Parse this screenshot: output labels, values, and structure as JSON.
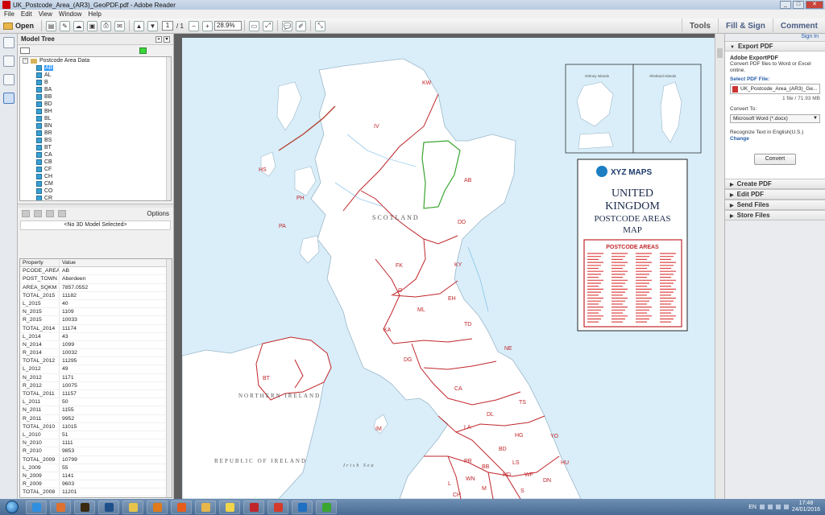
{
  "window": {
    "title": "UK_Postcode_Area_(AR3)_GeoPDF.pdf - Adobe Reader"
  },
  "menu": [
    "File",
    "Edit",
    "View",
    "Window",
    "Help"
  ],
  "toolbar": {
    "open_label": "Open",
    "page_current": "1",
    "page_total": "/ 1",
    "zoom": "28.9%",
    "tabs": [
      "Tools",
      "Fill & Sign",
      "Comment"
    ]
  },
  "left_strip_icons": [
    "pages-icon",
    "attachment-icon",
    "layers-icon",
    "model-tree-icon"
  ],
  "model_tree": {
    "title": "Model Tree",
    "root_label": "Postcode Area Data",
    "items": [
      "AB",
      "AL",
      "B",
      "BA",
      "BB",
      "BD",
      "BH",
      "BL",
      "BN",
      "BR",
      "BS",
      "BT",
      "CA",
      "CB",
      "CF",
      "CH",
      "CM",
      "CO",
      "CR"
    ],
    "selected": "AB",
    "options_label": "Options",
    "no_model_label": "<No 3D Model Selected>"
  },
  "properties": {
    "headers": [
      "Property",
      "Value"
    ],
    "rows": [
      [
        "PCODE_AREA",
        "AB"
      ],
      [
        "POST_TOWN",
        "Aberdeen"
      ],
      [
        "AREA_SQKM",
        "7857.0552"
      ],
      [
        "TOTAL_2015",
        "11182"
      ],
      [
        "L_2015",
        "40"
      ],
      [
        "N_2015",
        "1109"
      ],
      [
        "R_2015",
        "10033"
      ],
      [
        "TOTAL_2014",
        "11174"
      ],
      [
        "L_2014",
        "43"
      ],
      [
        "N_2014",
        "1099"
      ],
      [
        "R_2014",
        "10032"
      ],
      [
        "TOTAL_2012",
        "11295"
      ],
      [
        "L_2012",
        "49"
      ],
      [
        "N_2012",
        "1171"
      ],
      [
        "R_2012",
        "10075"
      ],
      [
        "TOTAL_2011",
        "11157"
      ],
      [
        "L_2011",
        "50"
      ],
      [
        "N_2011",
        "1155"
      ],
      [
        "R_2011",
        "9952"
      ],
      [
        "TOTAL_2010",
        "11015"
      ],
      [
        "L_2010",
        "51"
      ],
      [
        "N_2010",
        "1111"
      ],
      [
        "R_2010",
        "9853"
      ],
      [
        "TOTAL_2009",
        "10799"
      ],
      [
        "L_2009",
        "55"
      ],
      [
        "N_2009",
        "1141"
      ],
      [
        "R_2009",
        "9603"
      ],
      [
        "TOTAL_2008",
        "11201"
      ]
    ]
  },
  "map": {
    "brand": "XYZ MAPS",
    "title_lines": [
      "UNITED",
      "KINGDOM",
      "POSTCODE AREAS",
      "MAP"
    ],
    "legend_title": "POSTCODE AREAS",
    "inset_labels": [
      "Orkney Islands",
      "Shetland Islands"
    ],
    "place_labels": [
      "SCOTLAND",
      "NORTHERN IRELAND",
      "REPUBLIC OF IRELAND",
      "Irish Sea"
    ],
    "area_codes": [
      "KW",
      "IV",
      "HS",
      "PH",
      "AB",
      "DD",
      "PA",
      "FK",
      "KY",
      "G",
      "EH",
      "ML",
      "KA",
      "TD",
      "DG",
      "NE",
      "CA",
      "BT",
      "LA",
      "DL",
      "TS",
      "IM",
      "YO",
      "HG",
      "BD",
      "HU",
      "PR",
      "BB",
      "LS",
      "HD",
      "WF",
      "DN",
      "L",
      "WN",
      "M",
      "S",
      "CH"
    ],
    "colors": {
      "sea": "#d9eef9",
      "land": "#ffffff",
      "boundary": "#c0262b",
      "roads": "#7a7a7a",
      "water": "#6fb7e5"
    }
  },
  "export_panel": {
    "sign_in": "Sign In",
    "sections": [
      "Export PDF",
      "Create PDF",
      "Edit PDF",
      "Send Files",
      "Store Files"
    ],
    "service": "Adobe ExportPDF",
    "description": "Convert PDF files to Word or Excel online.",
    "select_label": "Select PDF File:",
    "file_name": "UK_Postcode_Area_(AR3)_Ge...",
    "file_count": "1 file / 71.93 MB",
    "convert_to_label": "Convert To:",
    "convert_to_value": "Microsoft Word (*.docx)",
    "recognize_label": "Recognize Text in English(U.S.)",
    "change_label": "Change",
    "convert_button": "Convert"
  },
  "taskbar": {
    "apps": [
      "ie-icon",
      "media-player-icon",
      "illustrator-icon",
      "photoshop-icon",
      "explorer-icon",
      "vlc-icon",
      "firefox-icon",
      "folder-icon",
      "notes-icon",
      "acrobat-icon",
      "act-icon",
      "outlook-icon",
      "evernote-icon"
    ],
    "language": "EN",
    "time": "17:48",
    "date": "24/01/2016"
  }
}
